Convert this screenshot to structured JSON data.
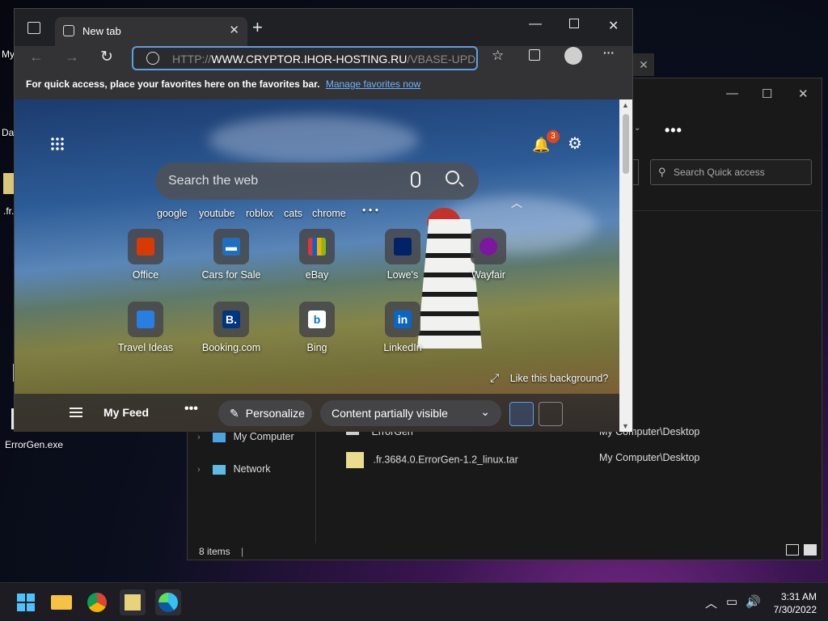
{
  "desktop": {
    "icons": [
      {
        "label": "My"
      },
      {
        "label": "Da"
      },
      {
        "label": ".fr."
      },
      {
        "label": "ErrorGen.exe"
      }
    ]
  },
  "explorer": {
    "search_placeholder": "Search Quick access",
    "more_label": "•••",
    "nav": [
      {
        "label": "My Computer"
      },
      {
        "label": "Network"
      }
    ],
    "rows": [
      {
        "name": "ErrorGen",
        "location": "My Computer\\Desktop"
      },
      {
        "name": ".fr.3684.0.ErrorGen-1.2_linux.tar",
        "location": "My Computer\\Desktop"
      }
    ],
    "status": "8 items"
  },
  "browser": {
    "tab_title": "New tab",
    "address_scheme": "HTTP://",
    "address_host": "WWW.CRYPTOR.IHOR-HOSTING.RU",
    "address_path": "/VBASE-UPDAT",
    "favorites_prompt": "For quick access, place your favorites here on the favorites bar.",
    "favorites_link": "Manage favorites now",
    "notification_count": "3",
    "search_placeholder": "Search the web",
    "quick_links": [
      "google",
      "youtube",
      "roblox",
      "cats",
      "chrome"
    ],
    "quick_more": "• • •",
    "tiles": [
      {
        "label": "Office"
      },
      {
        "label": "Cars for Sale"
      },
      {
        "label": "eBay"
      },
      {
        "label": "Lowe's"
      },
      {
        "label": "Wayfair"
      },
      {
        "label": "Travel Ideas"
      },
      {
        "label": "Booking.com"
      },
      {
        "label": "Bing"
      },
      {
        "label": "LinkedIn"
      }
    ],
    "like_background": "Like this background?",
    "feed": {
      "title": "My Feed",
      "dots": "•••",
      "personalize": "Personalize",
      "content_visibility": "Content partially visible"
    }
  },
  "taskbar": {
    "time": "3:31 AM",
    "date": "7/30/2022"
  }
}
